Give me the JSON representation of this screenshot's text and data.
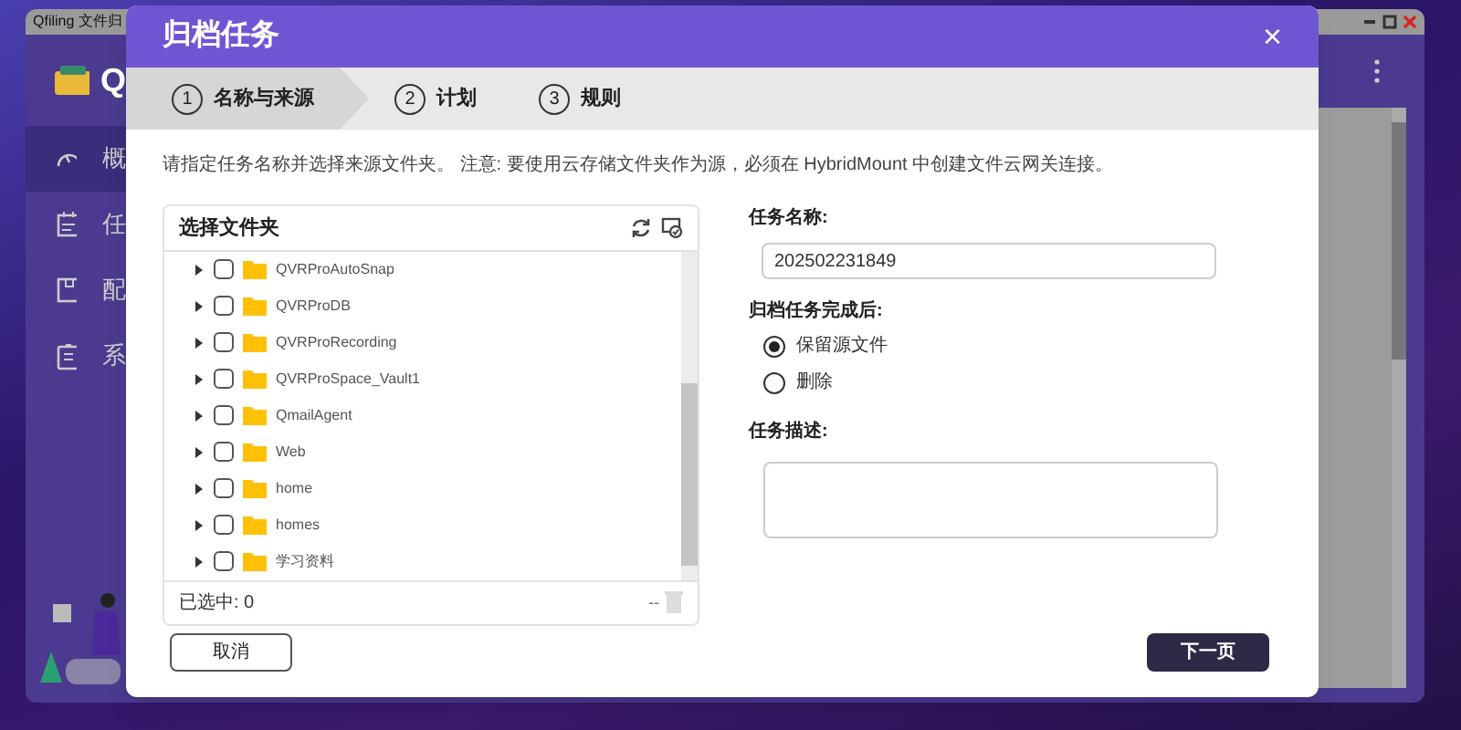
{
  "background_window": {
    "title": "Qfiling 文件归",
    "app_initial": "Q",
    "sidebar": [
      {
        "label": "概",
        "selected": true
      },
      {
        "label": "任",
        "selected": false
      },
      {
        "label": "配",
        "selected": false
      },
      {
        "label": "系",
        "selected": false
      }
    ]
  },
  "dialog": {
    "title": "归档任务",
    "close": "×",
    "steps": [
      {
        "number": "1",
        "label": "名称与来源",
        "selected": true
      },
      {
        "number": "2",
        "label": "计划",
        "selected": false
      },
      {
        "number": "3",
        "label": "规则",
        "selected": false
      }
    ],
    "instruction": "请指定任务名称并选择来源文件夹。 注意: 要使用云存储文件夹作为源，必须在 HybridMount 中创建文件云网关连接。",
    "folder_panel": {
      "title": "选择文件夹",
      "folders": [
        {
          "name": "QVRProAutoSnap",
          "checked": false,
          "expanded": false
        },
        {
          "name": "QVRProDB",
          "checked": false,
          "expanded": false
        },
        {
          "name": "QVRProRecording",
          "checked": false,
          "expanded": false
        },
        {
          "name": "QVRProSpace_Vault1",
          "checked": false,
          "expanded": false
        },
        {
          "name": "QmailAgent",
          "checked": false,
          "expanded": false
        },
        {
          "name": "Web",
          "checked": false,
          "expanded": false
        },
        {
          "name": "home",
          "checked": false,
          "expanded": false
        },
        {
          "name": "homes",
          "checked": false,
          "expanded": false
        },
        {
          "name": "学习资料",
          "checked": false,
          "expanded": false
        }
      ],
      "selected_count": "已选中: 0",
      "dash": "--"
    },
    "form": {
      "name_label": "任务名称:",
      "name_value": "202502231849",
      "after_label": "归档任务完成后:",
      "after_options": [
        {
          "label": "保留源文件",
          "selected": true
        },
        {
          "label": "删除",
          "selected": false
        }
      ],
      "description_label": "任务描述:"
    },
    "buttons": {
      "cancel": "取消",
      "next": "下一页"
    }
  }
}
